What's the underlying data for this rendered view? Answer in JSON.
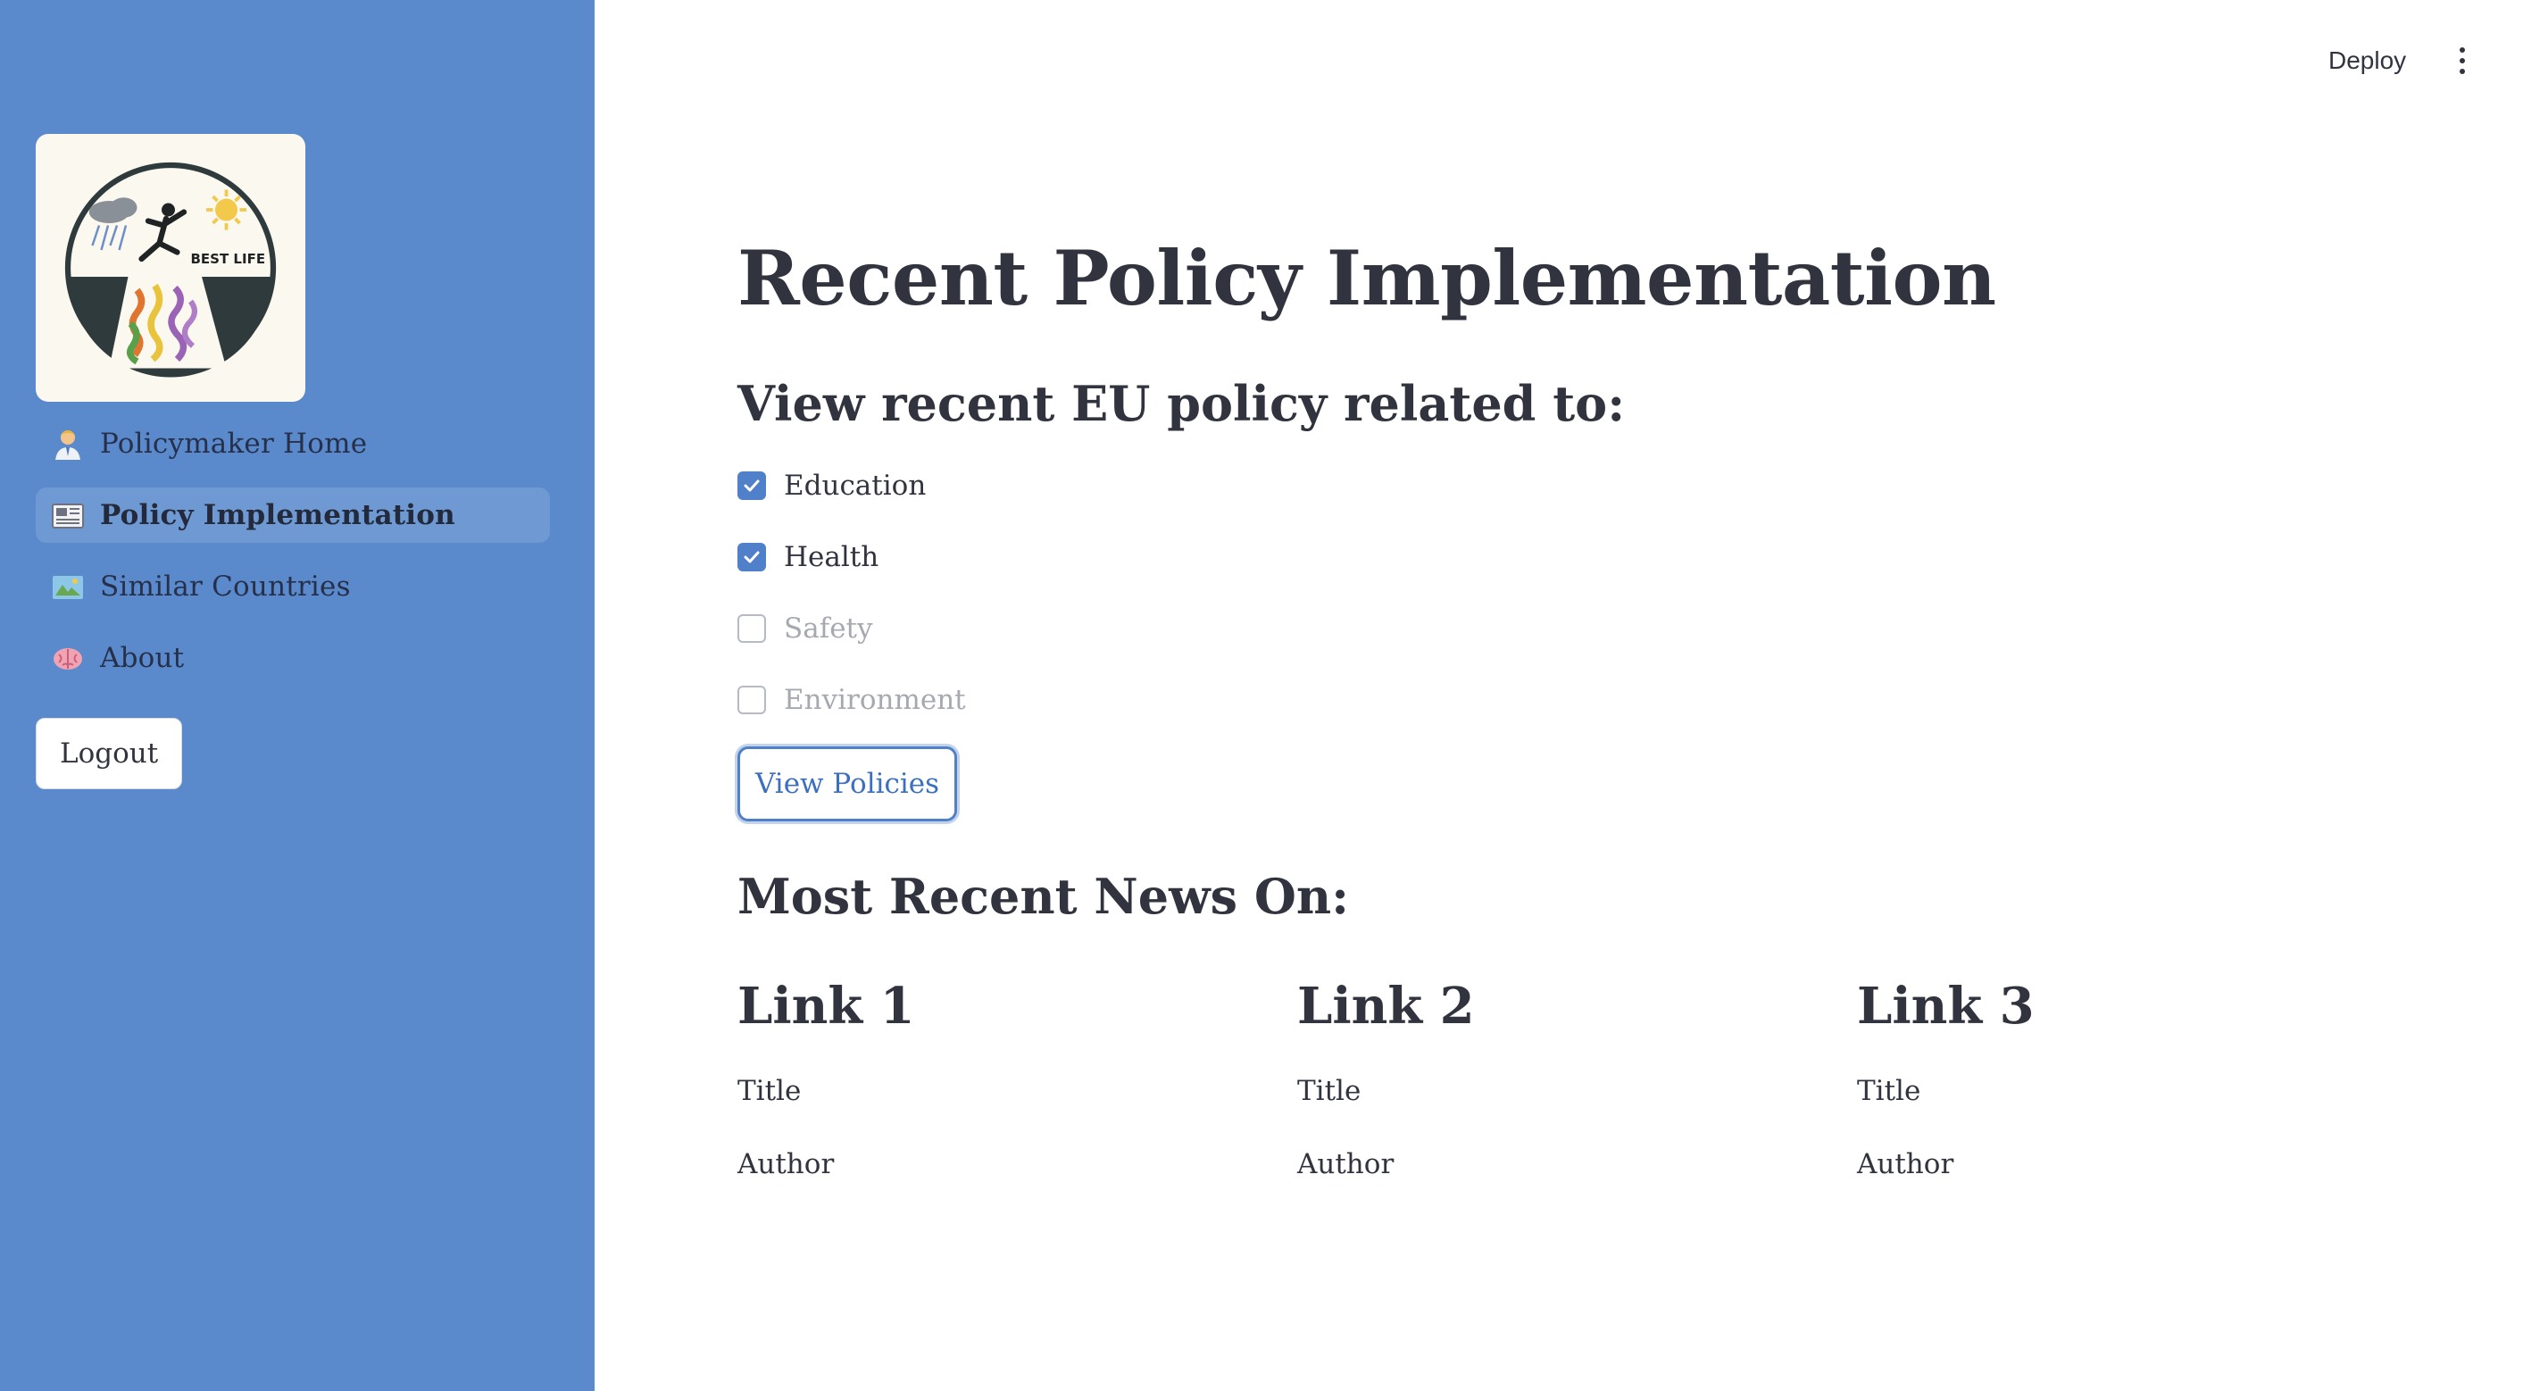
{
  "header": {
    "deploy_label": "Deploy",
    "menu_icon": "more-vertical-icon"
  },
  "sidebar": {
    "logo_text": "BEST LIFE",
    "items": [
      {
        "label": "Policymaker Home",
        "icon": "office-worker-icon",
        "active": false
      },
      {
        "label": "Policy Implementation",
        "icon": "newspaper-icon",
        "active": true
      },
      {
        "label": "Similar Countries",
        "icon": "map-icon",
        "active": false
      },
      {
        "label": "About",
        "icon": "brain-icon",
        "active": false
      }
    ],
    "logout_label": "Logout"
  },
  "main": {
    "title": "Recent Policy Implementation",
    "subheader": "View recent EU policy related to:",
    "checkboxes": [
      {
        "label": "Education",
        "checked": true
      },
      {
        "label": "Health",
        "checked": true
      },
      {
        "label": "Safety",
        "checked": false
      },
      {
        "label": "Environment",
        "checked": false
      }
    ],
    "view_button_label": "View Policies",
    "news_header": "Most Recent News On:",
    "news": [
      {
        "link": "Link 1",
        "title": "Title",
        "author": "Author"
      },
      {
        "link": "Link 2",
        "title": "Title",
        "author": "Author"
      },
      {
        "link": "Link 3",
        "title": "Title",
        "author": "Author"
      }
    ]
  },
  "colors": {
    "sidebar_bg": "#5a8acc",
    "accent": "#4f80c9",
    "text": "#31333f"
  }
}
